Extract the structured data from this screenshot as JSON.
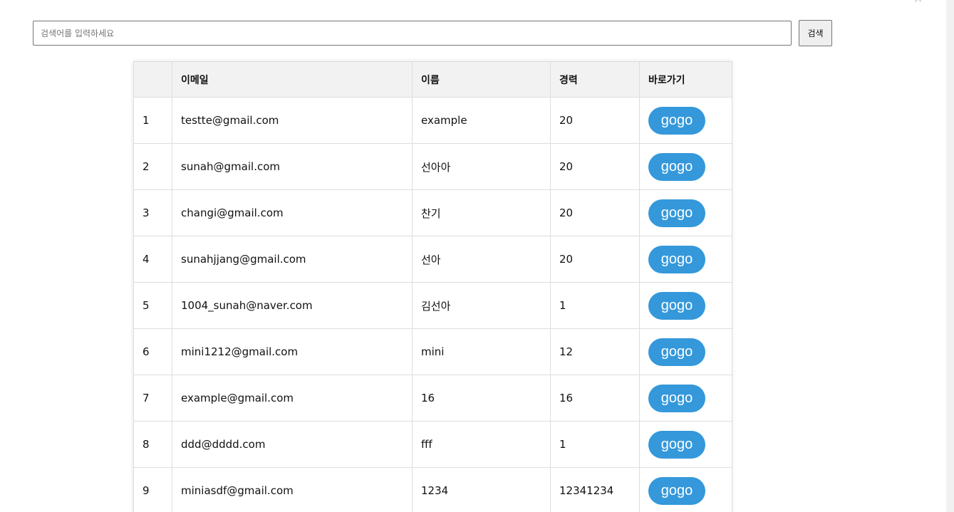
{
  "search": {
    "placeholder": "검색어를 입력하세요",
    "button_label": "검색"
  },
  "table": {
    "headers": [
      "",
      "이메일",
      "이름",
      "경력",
      "바로가기"
    ],
    "button_label": "gogo",
    "rows": [
      {
        "no": "1",
        "email": "testte@gmail.com",
        "name": "example",
        "career": "20"
      },
      {
        "no": "2",
        "email": "sunah@gmail.com",
        "name": "선아아",
        "career": "20"
      },
      {
        "no": "3",
        "email": "changi@gmail.com",
        "name": "찬기",
        "career": "20"
      },
      {
        "no": "4",
        "email": "sunahjjang@gmail.com",
        "name": "선아",
        "career": "20"
      },
      {
        "no": "5",
        "email": "1004_sunah@naver.com",
        "name": "김선아",
        "career": "1"
      },
      {
        "no": "6",
        "email": "mini1212@gmail.com",
        "name": "mini",
        "career": "12"
      },
      {
        "no": "7",
        "email": "example@gmail.com",
        "name": "16",
        "career": "16"
      },
      {
        "no": "8",
        "email": "ddd@dddd.com",
        "name": "fff",
        "career": "1"
      },
      {
        "no": "9",
        "email": "miniasdf@gmail.com",
        "name": "1234",
        "career": "12341234"
      }
    ]
  },
  "colors": {
    "button_bg": "#3498db",
    "header_bg": "#f2f2f2",
    "border": "#dddddd"
  }
}
